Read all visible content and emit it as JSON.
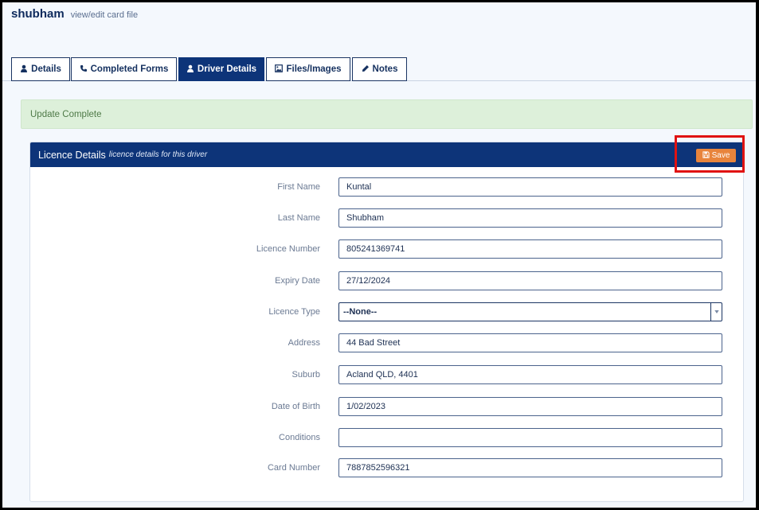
{
  "header": {
    "name": "shubham",
    "subtitle": "view/edit card file"
  },
  "tabs": [
    {
      "label": "Details",
      "icon": "user-icon"
    },
    {
      "label": "Completed Forms",
      "icon": "phone-icon"
    },
    {
      "label": "Driver Details",
      "icon": "user-icon",
      "active": true
    },
    {
      "label": "Files/Images",
      "icon": "image-icon"
    },
    {
      "label": "Notes",
      "icon": "pencil-icon"
    }
  ],
  "alert": {
    "message": "Update Complete"
  },
  "panel": {
    "title": "Licence Details",
    "subtitle": "licence details for this driver",
    "save_label": "Save"
  },
  "form": {
    "first_name": {
      "label": "First Name",
      "value": "Kuntal"
    },
    "last_name": {
      "label": "Last Name",
      "value": "Shubham"
    },
    "licence_number": {
      "label": "Licence Number",
      "value": "805241369741"
    },
    "expiry_date": {
      "label": "Expiry Date",
      "value": "27/12/2024"
    },
    "licence_type": {
      "label": "Licence Type",
      "value": "--None--"
    },
    "address": {
      "label": "Address",
      "value": "44 Bad Street"
    },
    "suburb": {
      "label": "Suburb",
      "value": "Acland QLD, 4401"
    },
    "date_of_birth": {
      "label": "Date of Birth",
      "value": "1/02/2023"
    },
    "conditions": {
      "label": "Conditions",
      "value": ""
    },
    "card_number": {
      "label": "Card Number",
      "value": "7887852596321"
    }
  },
  "colors": {
    "primary": "#0d3479",
    "accent": "#e8843c",
    "success_bg": "#ddf0da",
    "highlight": "#e01212"
  }
}
